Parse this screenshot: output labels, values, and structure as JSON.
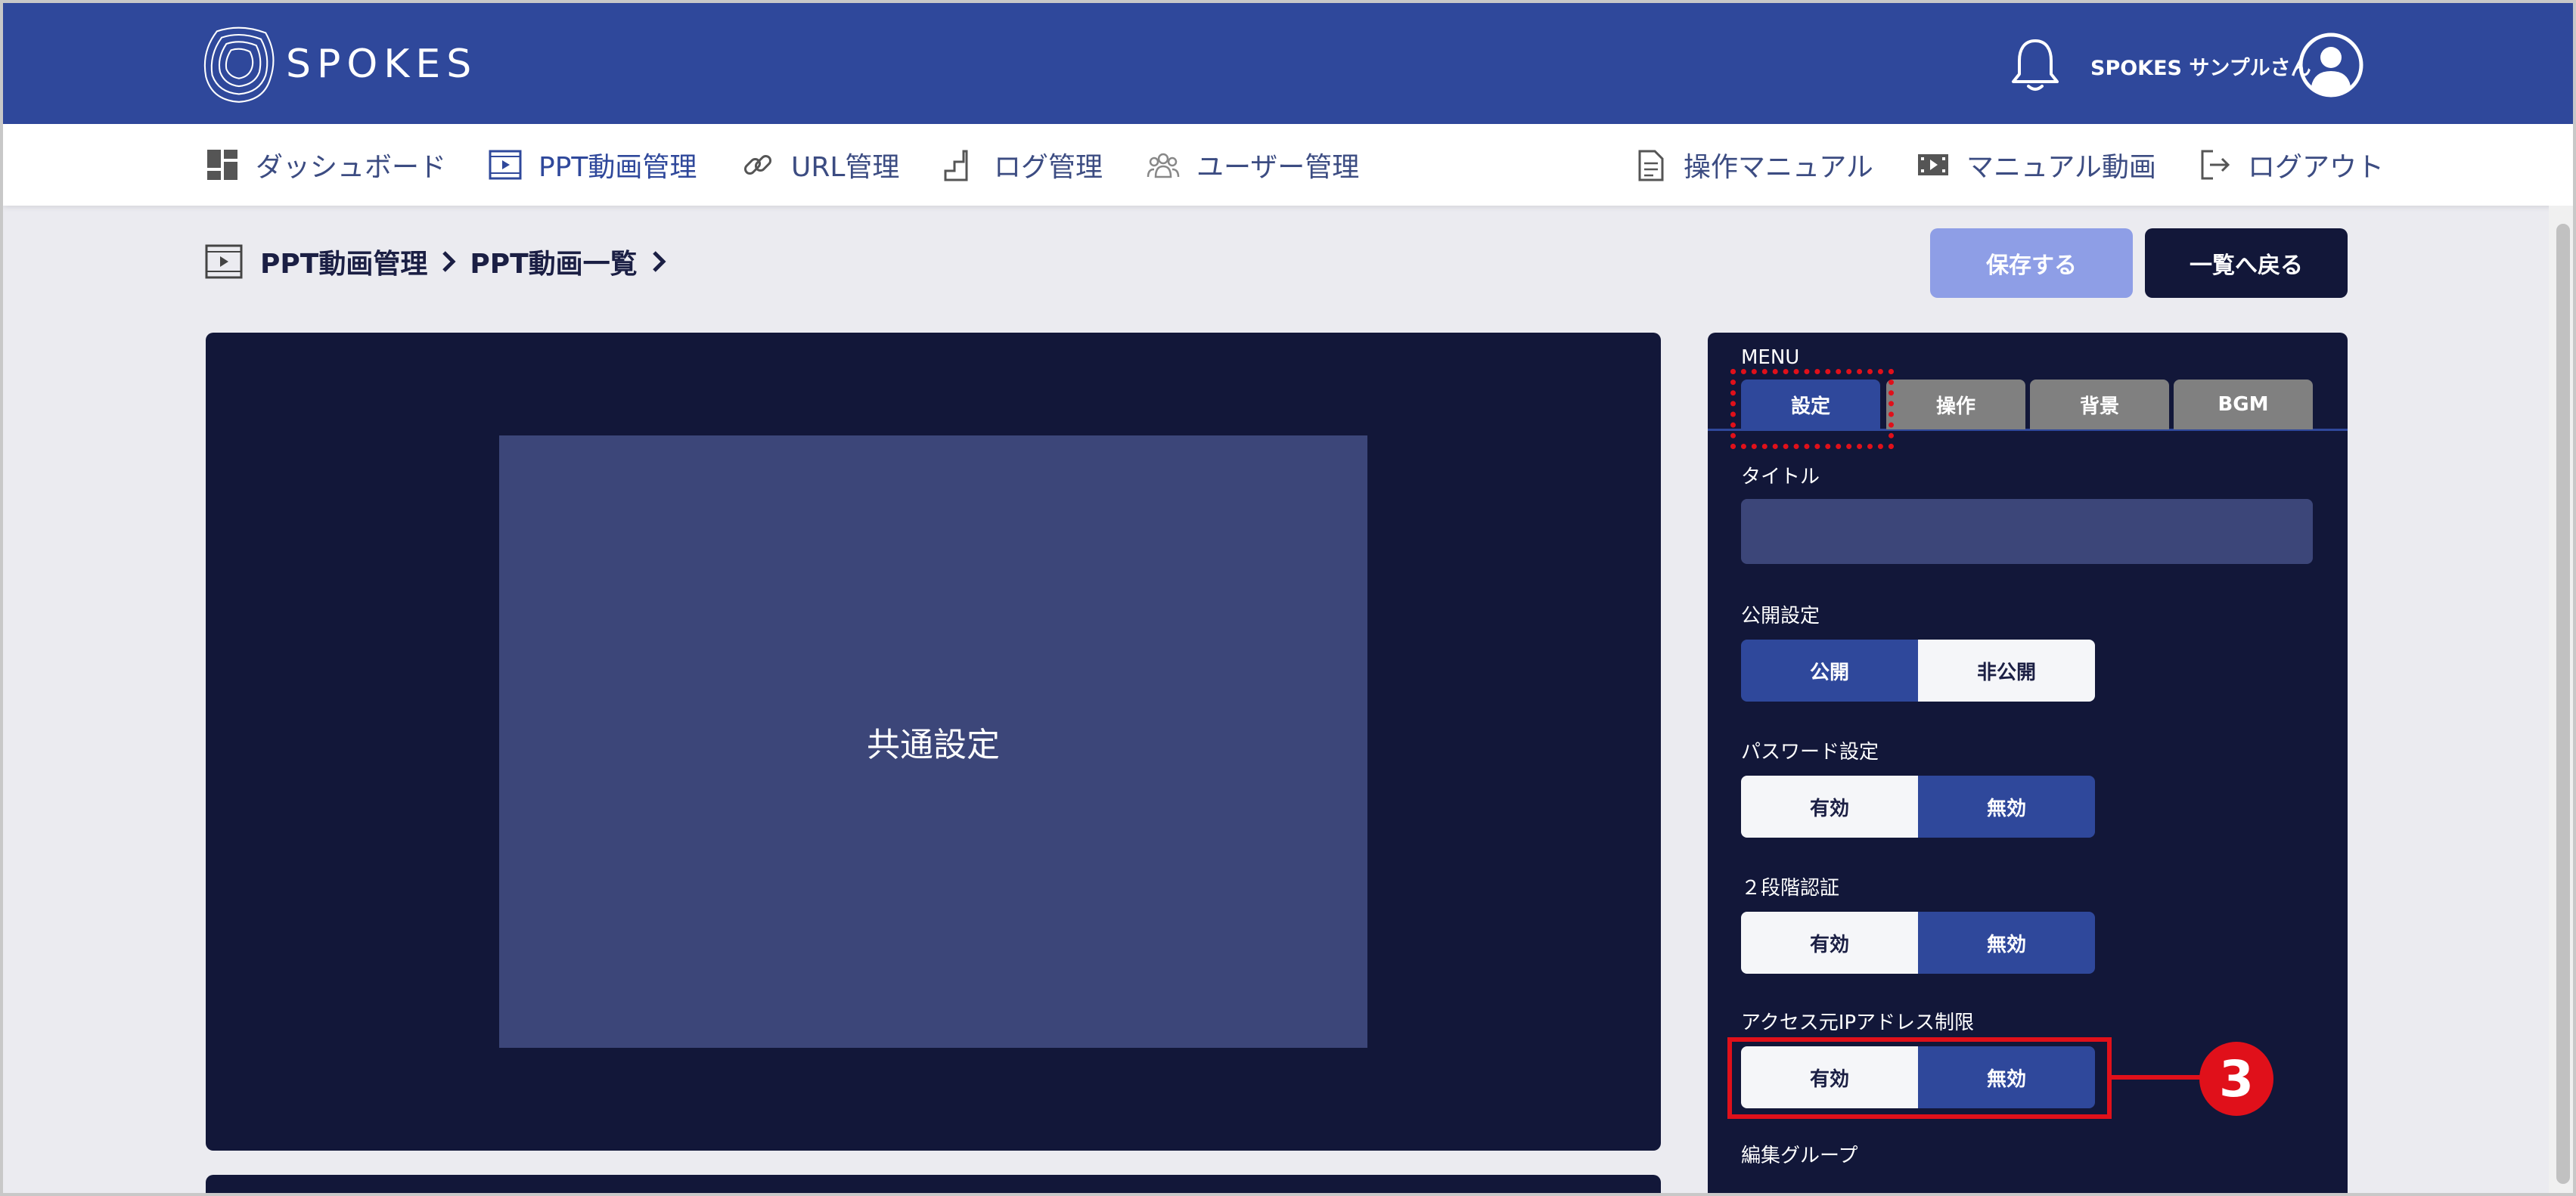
{
  "brand": {
    "name": "SPOKES"
  },
  "header": {
    "user_name": "SPOKES サンプルさん"
  },
  "nav": {
    "left": [
      {
        "label": "ダッシュボード",
        "icon": "dashboard-icon"
      },
      {
        "label": "PPT動画管理",
        "icon": "film-icon"
      },
      {
        "label": "URL管理",
        "icon": "link-icon"
      },
      {
        "label": "ログ管理",
        "icon": "stairs-icon"
      },
      {
        "label": "ユーザー管理",
        "icon": "users-icon"
      }
    ],
    "right": [
      {
        "label": "操作マニュアル",
        "icon": "document-icon"
      },
      {
        "label": "マニュアル動画",
        "icon": "video-icon"
      },
      {
        "label": "ログアウト",
        "icon": "logout-icon"
      }
    ]
  },
  "breadcrumb": {
    "items": [
      "PPT動画管理",
      "PPT動画一覧"
    ]
  },
  "actions": {
    "save": "保存する",
    "back": "一覧へ戻る"
  },
  "preview": {
    "label": "共通設定"
  },
  "panel": {
    "menu_label": "MENU",
    "tabs": [
      "設定",
      "操作",
      "背景",
      "BGM"
    ],
    "active_tab": "設定",
    "title_label": "タイトル",
    "title_value": "",
    "publish": {
      "label": "公開設定",
      "options": [
        "公開",
        "非公開"
      ],
      "selected": "公開"
    },
    "password": {
      "label": "パスワード設定",
      "options": [
        "有効",
        "無効"
      ],
      "selected": "無効"
    },
    "two_factor": {
      "label": "２段階認証",
      "options": [
        "有効",
        "無効"
      ],
      "selected": "無効"
    },
    "ip_restriction": {
      "label": "アクセス元IPアドレス制限",
      "options": [
        "有効",
        "無効"
      ],
      "selected": "無効"
    },
    "edit_group": {
      "label": "編集グループ"
    }
  },
  "annotation": {
    "step": "3"
  },
  "colors": {
    "header_bg": "#2f489b",
    "dark_navy": "#121739",
    "accent": "#2f489b",
    "highlight_red": "#e0101a",
    "tab_inactive": "#808080"
  }
}
